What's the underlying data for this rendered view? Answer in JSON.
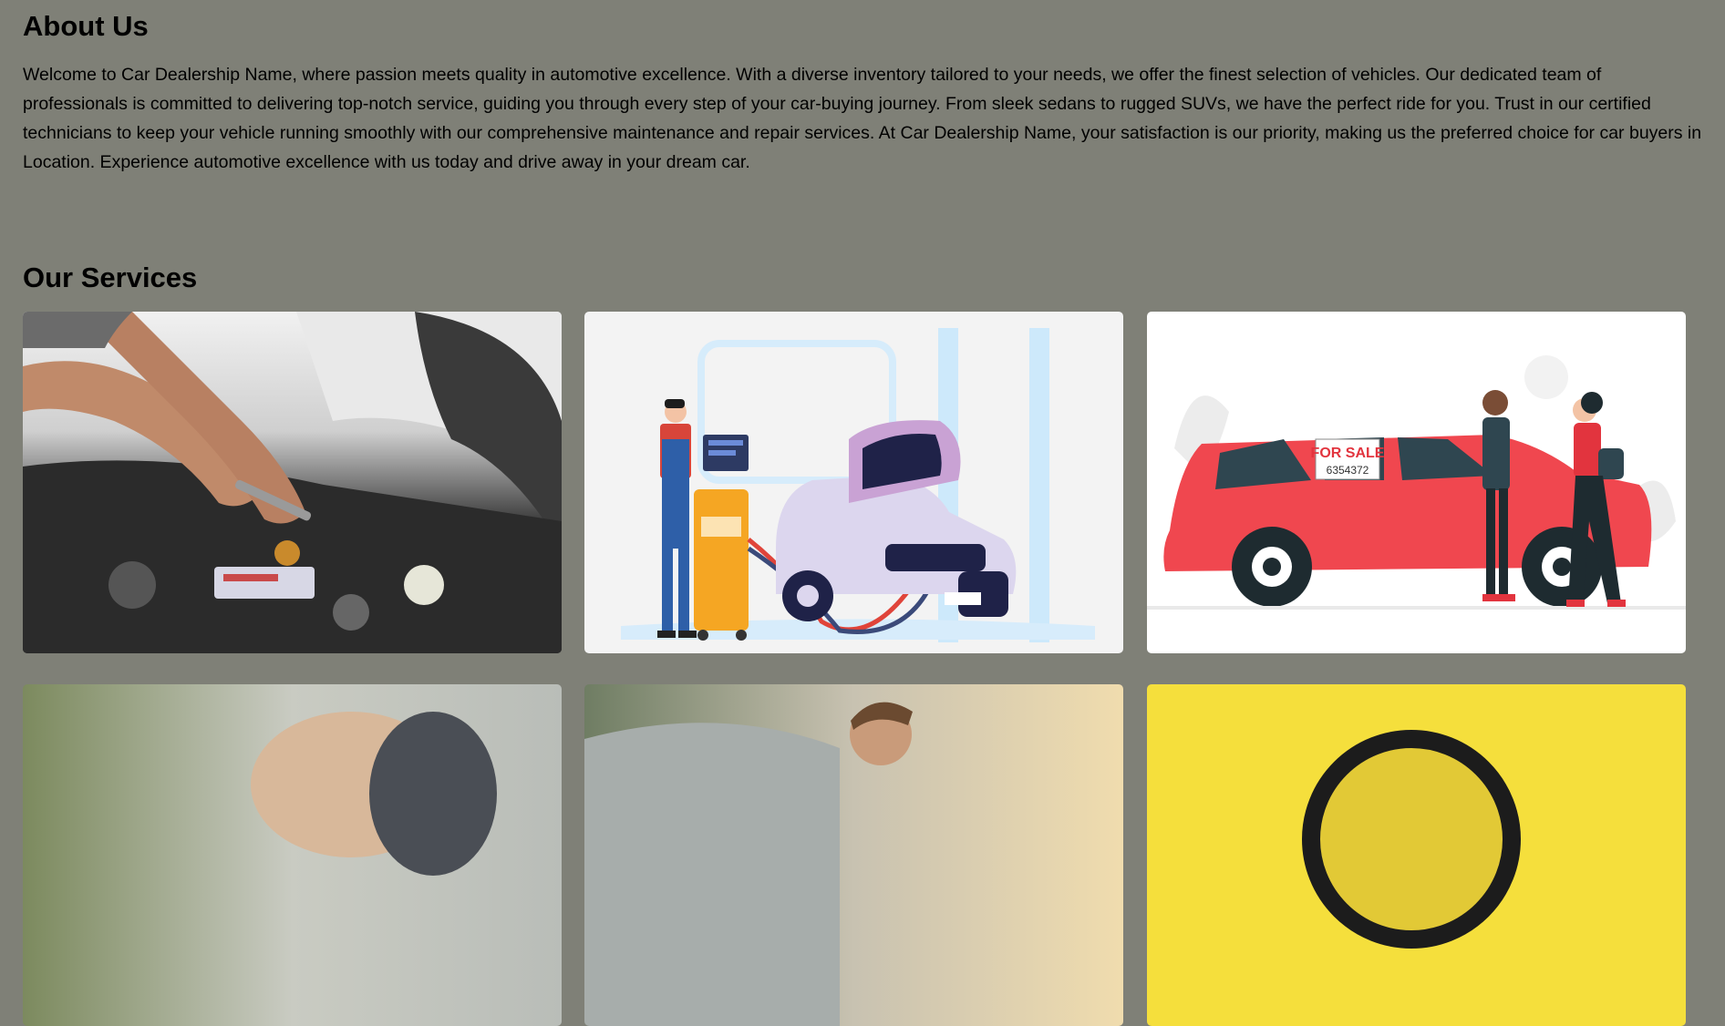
{
  "about": {
    "heading": "About Us",
    "text": "Welcome to Car Dealership Name, where passion meets quality in automotive excellence. With a diverse inventory tailored to your needs, we offer the finest selection of vehicles. Our dedicated team of professionals is committed to delivering top-notch service, guiding you through every step of your car-buying journey. From sleek sedans to rugged SUVs, we have the perfect ride for you. Trust in our certified technicians to keep your vehicle running smoothly with our comprehensive maintenance and repair services. At Car Dealership Name, your satisfaction is our priority, making us the preferred choice for car buyers in Location. Experience automotive excellence with us today and drive away in your dream car."
  },
  "services": {
    "heading": "Our Services",
    "cards": [
      {
        "image": "mechanic-engine-photo"
      },
      {
        "image": "car-diagnostics-illustration"
      },
      {
        "image": "car-sale-illustration",
        "sign_text": "FOR SALE",
        "sign_number": "6354372"
      },
      {
        "image": "car-keys-hand-photo"
      },
      {
        "image": "man-inspecting-car-photo"
      },
      {
        "image": "magnifier-yellow-photo"
      }
    ]
  },
  "colors": {
    "page_background": "#7f8077",
    "sale_car_red": "#f0474f"
  }
}
